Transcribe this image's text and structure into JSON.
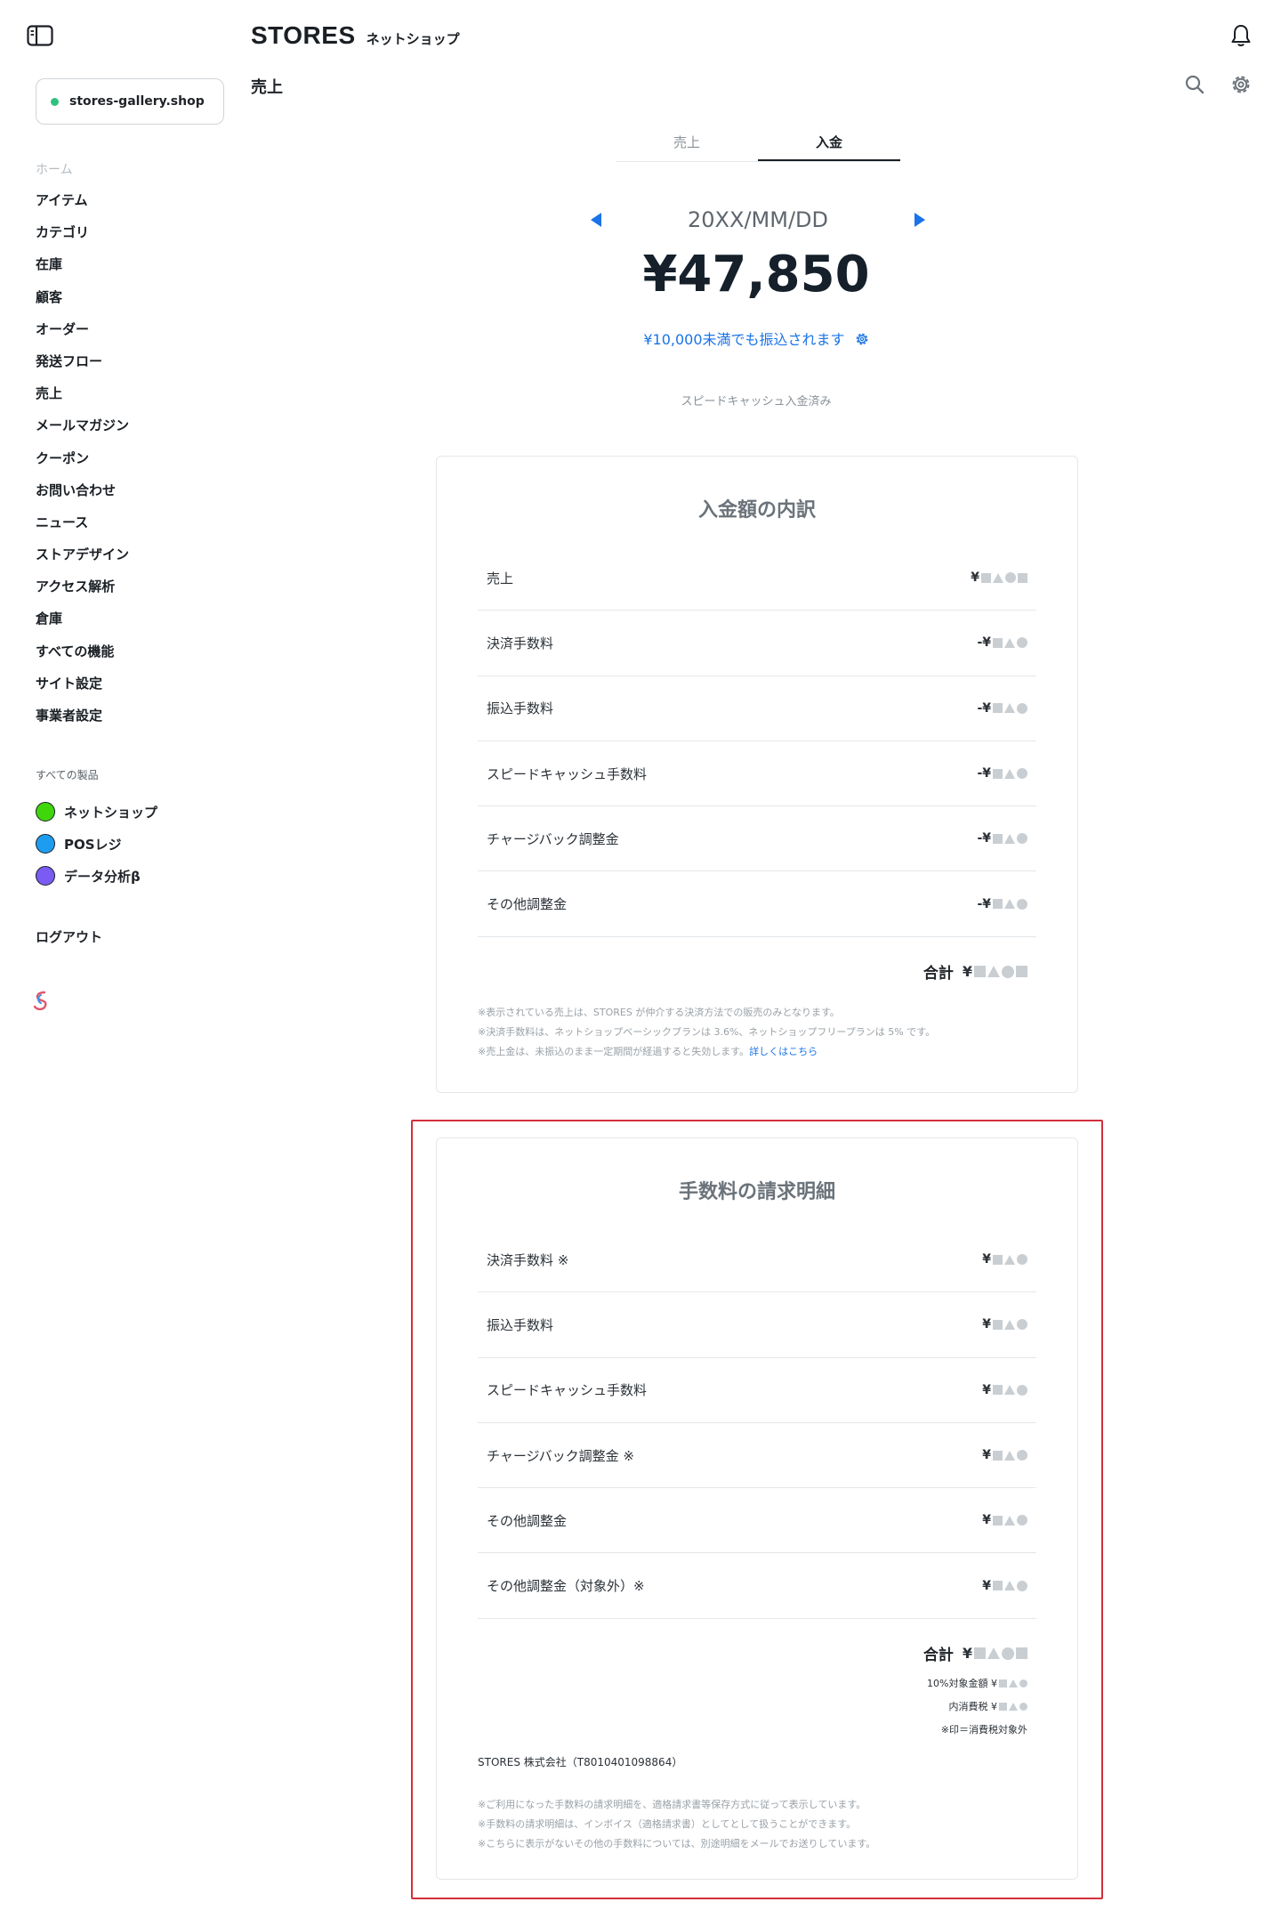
{
  "header": {
    "brand": "STORES",
    "brand_sub": "ネットショップ",
    "page_title": "売上"
  },
  "sidebar": {
    "shop_name": "stores-gallery.shop",
    "home": "ホーム",
    "items": [
      "アイテム",
      "カテゴリ",
      "在庫",
      "顧客",
      "オーダー",
      "発送フロー",
      "売上",
      "メールマガジン",
      "クーポン",
      "お問い合わせ",
      "ニュース",
      "ストアデザイン",
      "アクセス解析",
      "倉庫",
      "すべての機能",
      "サイト設定",
      "事業者設定"
    ],
    "products_label": "すべての製品",
    "products": [
      {
        "label": "ネットショップ",
        "color": "#3fd60c"
      },
      {
        "label": "POSレジ",
        "color": "#1e9df0"
      },
      {
        "label": "データ分析β",
        "color": "#7a5cf2"
      }
    ],
    "logout": "ログアウト"
  },
  "tabs": [
    {
      "label": "売上",
      "active": false
    },
    {
      "label": "入金",
      "active": true
    }
  ],
  "summary": {
    "date": "20XX/MM/DD",
    "amount": "¥47,850",
    "transfer_note": "¥10,000未満でも振込されます",
    "speed_note": "スピードキャッシュ入金済み"
  },
  "breakdown": {
    "title": "入金額の内訳",
    "rows": [
      {
        "label": "売上",
        "prefix": "¥"
      },
      {
        "label": "決済手数料",
        "prefix": "-¥"
      },
      {
        "label": "振込手数料",
        "prefix": "-¥"
      },
      {
        "label": "スピードキャッシュ手数料",
        "prefix": "-¥"
      },
      {
        "label": "チャージバック調整金",
        "prefix": "-¥"
      },
      {
        "label": "その他調整金",
        "prefix": "-¥"
      }
    ],
    "total_label": "合計",
    "total_prefix": "¥",
    "notes": [
      "※表示されている売上は、STORES が仲介する決済方法での販売のみとなります。",
      "※決済手数料は、ネットショップベーシックプランは 3.6%、ネットショップフリープランは 5% です。",
      "※売上金は、未振込のまま一定期間が経過すると失効します。"
    ],
    "notes_link": "詳しくはこちら"
  },
  "invoice": {
    "title": "手数料の請求明細",
    "rows": [
      {
        "label": "決済手数料 ※",
        "prefix": "¥"
      },
      {
        "label": "振込手数料",
        "prefix": "¥"
      },
      {
        "label": "スピードキャッシュ手数料",
        "prefix": "¥"
      },
      {
        "label": "チャージバック調整金 ※",
        "prefix": "¥"
      },
      {
        "label": "その他調整金",
        "prefix": "¥"
      },
      {
        "label": "その他調整金（対象外）※",
        "prefix": "¥"
      }
    ],
    "total_label": "合計",
    "total_prefix": "¥",
    "tax_target_label": "10%対象金額 ¥",
    "tax_included_label": "内消費税 ¥",
    "tax_exempt_note": "※印＝消費税対象外",
    "company": "STORES 株式会社（T8010401098864）",
    "notes": [
      "※ご利用になった手数料の請求明細を、適格請求書等保存方式に従って表示しています。",
      "※手数料の請求明細は、インボイス（適格請求書）としてとして扱うことができます。",
      "※こちらに表示がないその他の手数料については、別途明細をメールでお送りしています。"
    ]
  },
  "colors": {
    "accent": "#1a73e8",
    "highlight_border": "#d32f3a",
    "shop_status": "#2ec27e"
  }
}
